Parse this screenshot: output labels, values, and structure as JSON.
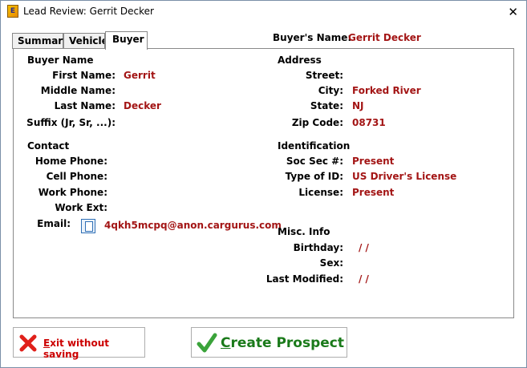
{
  "window": {
    "title": "Lead Review: Gerrit Decker",
    "close_glyph": "✕"
  },
  "tabs": [
    {
      "label": "Summary",
      "active": false
    },
    {
      "label": "Vehicle",
      "active": false
    },
    {
      "label": "Buyer",
      "active": true
    }
  ],
  "header": {
    "buyer_name_label": "Buyer's Name:",
    "buyer_name_value": "Gerrit Decker"
  },
  "buyer_name": {
    "title": "Buyer Name",
    "first_name_label": "First Name:",
    "first_name": "Gerrit",
    "middle_name_label": "Middle Name:",
    "middle_name": "",
    "last_name_label": "Last Name:",
    "last_name": "Decker",
    "suffix_label": "Suffix (Jr, Sr, ...):",
    "suffix": ""
  },
  "contact": {
    "title": "Contact",
    "home_phone_label": "Home Phone:",
    "home_phone": "",
    "cell_phone_label": "Cell Phone:",
    "cell_phone": "",
    "work_phone_label": "Work Phone:",
    "work_phone": "",
    "work_ext_label": "Work Ext:",
    "work_ext": "",
    "email_label": "Email:",
    "email": "4qkh5mcpq@anon.cargurus.com"
  },
  "address": {
    "title": "Address",
    "street_label": "Street:",
    "street": "",
    "city_label": "City:",
    "city": "Forked River",
    "state_label": "State:",
    "state": "NJ",
    "zip_label": "Zip Code:",
    "zip": "08731"
  },
  "identification": {
    "title": "Identification",
    "ssn_label": "Soc Sec #:",
    "ssn": "Present",
    "id_type_label": "Type of ID:",
    "id_type": "US Driver's License",
    "license_label": "License:",
    "license": "Present"
  },
  "misc": {
    "title": "Misc. Info",
    "birthday_label": "Birthday:",
    "birthday": "/  /",
    "sex_label": "Sex:",
    "sex": "",
    "last_modified_label": "Last Modified:",
    "last_modified": "/  /"
  },
  "buttons": {
    "exit_hotkey": "E",
    "exit_rest": "xit without saving",
    "create_hotkey": "C",
    "create_rest": "reate Prospect"
  },
  "colors": {
    "value_text": "#a31515",
    "exit_red": "#cc0000",
    "create_green": "#1a7a1a"
  },
  "icons": {
    "exit": "red-x-icon",
    "create": "green-check-icon",
    "email": "document-icon"
  }
}
